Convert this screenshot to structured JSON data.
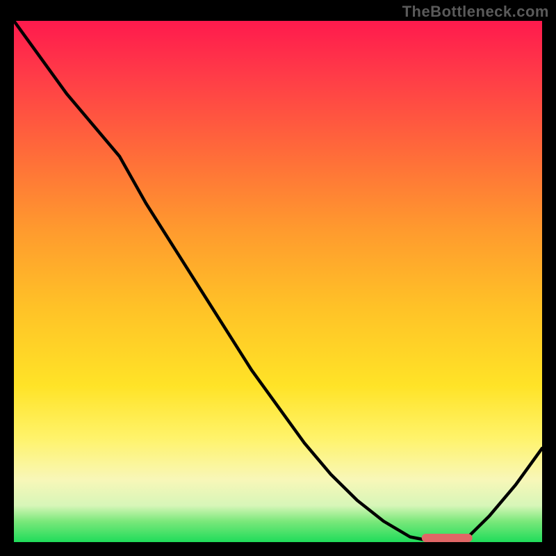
{
  "watermark": "TheBottleneck.com",
  "chart_data": {
    "type": "line",
    "title": "",
    "xlabel": "",
    "ylabel": "",
    "x": [
      0.0,
      0.05,
      0.1,
      0.15,
      0.2,
      0.25,
      0.3,
      0.35,
      0.4,
      0.45,
      0.5,
      0.55,
      0.6,
      0.65,
      0.7,
      0.75,
      0.8,
      0.82,
      0.85,
      0.9,
      0.95,
      1.0
    ],
    "values": [
      1.0,
      0.93,
      0.86,
      0.8,
      0.74,
      0.65,
      0.57,
      0.49,
      0.41,
      0.33,
      0.26,
      0.19,
      0.13,
      0.08,
      0.04,
      0.01,
      0.0,
      0.0,
      0.0,
      0.05,
      0.11,
      0.18
    ],
    "xlim": [
      0,
      1
    ],
    "ylim": [
      0,
      1
    ],
    "marker": {
      "present": true,
      "color": "#e06666",
      "x_start": 0.78,
      "x_end": 0.86,
      "y": 0.0,
      "note": "short horizontal pink segment at minimum"
    },
    "background_gradient": {
      "top": "#ff1a4d",
      "mid_high": "#ff9a2e",
      "mid_low": "#ffe327",
      "bottom": "#1fdc5a"
    },
    "series_color": "#000000"
  }
}
